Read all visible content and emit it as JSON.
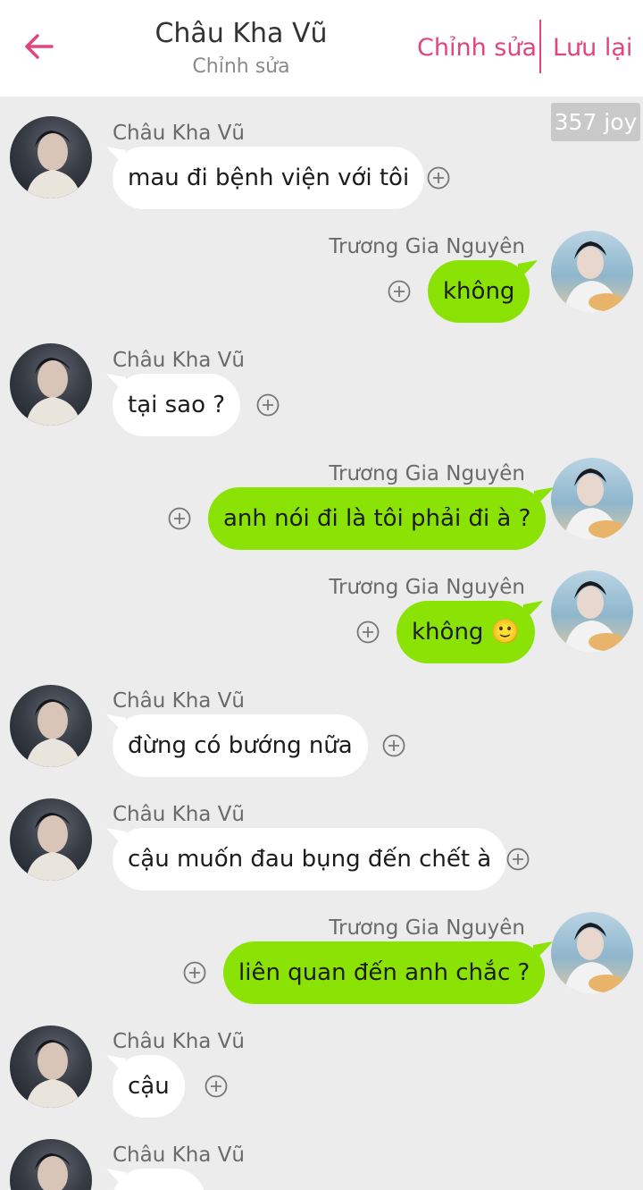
{
  "header": {
    "title": "Châu Kha Vũ",
    "subtitle": "Chỉnh sửa",
    "edit_label": "Chỉnh sửa",
    "save_label": "Lưu lại",
    "accent_color": "#e0457b"
  },
  "badge": {
    "text": "357 joy"
  },
  "messages": [
    {
      "sender": "Châu Kha Vũ",
      "side": "left",
      "text": "mau đi bệnh viện với tôi"
    },
    {
      "sender": "Trương Gia Nguyên",
      "side": "right",
      "text": "không"
    },
    {
      "sender": "Châu Kha Vũ",
      "side": "left",
      "text": "tại sao ?"
    },
    {
      "sender": "Trương Gia Nguyên",
      "side": "right",
      "text": "anh nói đi là tôi phải đi à ?"
    },
    {
      "sender": "Trương Gia Nguyên",
      "side": "right",
      "text": "không 🙂"
    },
    {
      "sender": "Châu Kha Vũ",
      "side": "left",
      "text": "đừng có bướng nữa"
    },
    {
      "sender": "Châu Kha Vũ",
      "side": "left",
      "text": "cậu muốn đau bụng đến chết à"
    },
    {
      "sender": "Trương Gia Nguyên",
      "side": "right",
      "text": "liên quan đến anh chắc ?"
    },
    {
      "sender": "Châu Kha Vũ",
      "side": "left",
      "text": "cậu"
    },
    {
      "sender": "Châu Kha Vũ",
      "side": "left",
      "text": ""
    }
  ],
  "colors": {
    "left_bubble": "#ffffff",
    "right_bubble": "#8be306",
    "background": "#ececec"
  }
}
